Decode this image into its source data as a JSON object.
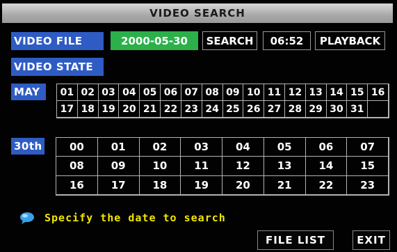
{
  "window": {
    "title": "VIDEO SEARCH"
  },
  "video_file": {
    "label": "VIDEO FILE",
    "date": "2000-05-30",
    "search_label": "SEARCH",
    "time": "06:52",
    "playback_label": "PLAYBACK"
  },
  "video_state": {
    "label": "VIDEO STATE"
  },
  "month": {
    "label": "MAY",
    "days": [
      "01",
      "02",
      "03",
      "04",
      "05",
      "06",
      "07",
      "08",
      "09",
      "10",
      "11",
      "12",
      "13",
      "14",
      "15",
      "16",
      "17",
      "18",
      "19",
      "20",
      "21",
      "22",
      "23",
      "24",
      "25",
      "26",
      "27",
      "28",
      "29",
      "30",
      "31"
    ],
    "selected_day": "30"
  },
  "hours": {
    "day_label": "30th",
    "values": [
      "00",
      "01",
      "02",
      "03",
      "04",
      "05",
      "06",
      "07",
      "08",
      "09",
      "10",
      "11",
      "12",
      "13",
      "14",
      "15",
      "16",
      "17",
      "18",
      "19",
      "20",
      "21",
      "22",
      "23"
    ]
  },
  "hint": {
    "text": "Specify the date to search",
    "icon": "speech-bubble-icon"
  },
  "footer": {
    "file_list_label": "FILE LIST",
    "exit_label": "EXIT"
  },
  "colors": {
    "accent_blue": "#2f5cc4",
    "date_green": "#2bb04a",
    "hint_yellow": "#f2e600",
    "title_gray": "#b8b8b8"
  }
}
